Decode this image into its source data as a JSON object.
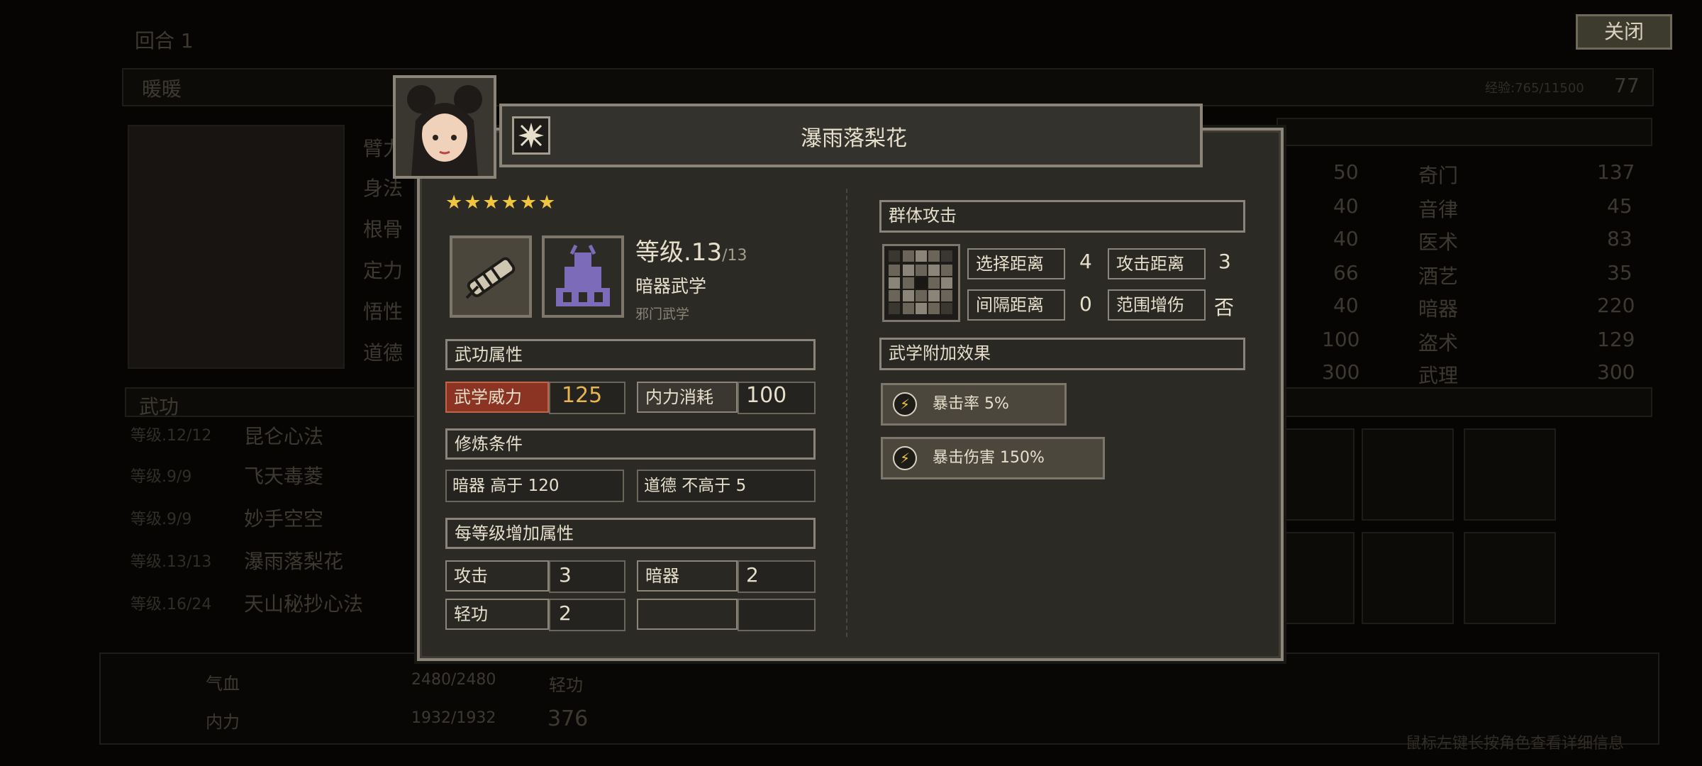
{
  "background": {
    "turn_label": "回合 1",
    "character_name": "暖暖",
    "exp_text": "经验:765/11500",
    "level": "77",
    "attrs_left": [
      "臂力",
      "身法",
      "根骨",
      "定力",
      "悟性",
      "道德"
    ],
    "stats_mid": [
      "50",
      "40",
      "40",
      "66",
      "40",
      "100",
      "300"
    ],
    "skills_right": [
      {
        "name": "奇门",
        "value": "137"
      },
      {
        "name": "音律",
        "value": "45"
      },
      {
        "name": "医术",
        "value": "83"
      },
      {
        "name": "酒艺",
        "value": "35"
      },
      {
        "name": "暗器",
        "value": "220"
      },
      {
        "name": "盗术",
        "value": "129"
      },
      {
        "name": "武理",
        "value": "300"
      }
    ],
    "martial_header": "武功",
    "martial_list": [
      {
        "level": "等级.12/12",
        "name": "昆仑心法"
      },
      {
        "level": "等级.9/9",
        "name": "飞天毒菱"
      },
      {
        "level": "等级.9/9",
        "name": "妙手空空"
      },
      {
        "level": "等级.13/13",
        "name": "瀑雨落梨花"
      },
      {
        "level": "等级.16/24",
        "name": "天山秘抄心法"
      }
    ],
    "hp_label": "气血",
    "hp_value": "2480/2480",
    "mp_label": "内力",
    "mp_value": "1932/1932",
    "qinggong_label": "轻功",
    "qinggong_value": "376",
    "hint": "鼠标左键长按角色查看详细信息"
  },
  "close_button": "关闭",
  "skill": {
    "title": "瀑雨落梨花",
    "stars": "★★★★★★",
    "level": "等级.13",
    "level_max": "/13",
    "category": "暗器武学",
    "school": "邪门武学",
    "props_header": "武功属性",
    "power_label": "武学威力",
    "power_value": "125",
    "mp_cost_label": "内力消耗",
    "mp_cost_value": "100",
    "req_header": "修炼条件",
    "req1": "暗器 高于 120",
    "req2": "道德 不高于 5",
    "perlevel_header": "每等级增加属性",
    "perlevel": [
      {
        "label": "攻击",
        "value": "3"
      },
      {
        "label": "暗器",
        "value": "2"
      },
      {
        "label": "轻功",
        "value": "2"
      }
    ],
    "attack_type": "群体攻击",
    "select_range_label": "选择距离",
    "select_range_value": "4",
    "attack_range_label": "攻击距离",
    "attack_range_value": "3",
    "interval_label": "间隔距离",
    "interval_value": "0",
    "aoe_bonus_label": "范围增伤",
    "aoe_bonus_value": "否",
    "extra_header": "武学附加效果",
    "effects": [
      {
        "label": "暴击率 5%"
      },
      {
        "label": "暴击伤害 150%"
      }
    ]
  },
  "colors": {
    "power_red": "#8c3424",
    "gold": "#e9b64d",
    "star": "#f0c640"
  }
}
